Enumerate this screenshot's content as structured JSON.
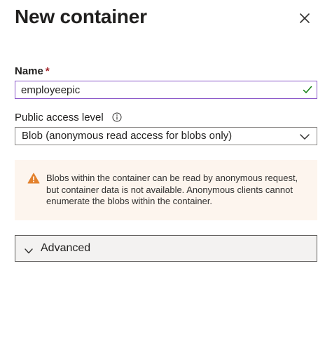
{
  "panel": {
    "title": "New container",
    "close_icon": "close-icon"
  },
  "name_field": {
    "label": "Name",
    "required_marker": "*",
    "value": "employeepic",
    "valid_icon": "checkmark-icon"
  },
  "access_level": {
    "label": "Public access level",
    "info_icon": "info-icon",
    "selected": "Blob (anonymous read access for blobs only)",
    "chevron_icon": "chevron-down-icon"
  },
  "warning": {
    "icon": "warning-icon",
    "text": "Blobs within the container can be read by anonymous request, but container data is not available. Anonymous clients cannot enumerate the blobs within the container."
  },
  "advanced": {
    "label": "Advanced",
    "chevron_icon": "chevron-down-icon"
  },
  "colors": {
    "required": "#a4262c",
    "focus_border": "#8a56c8",
    "valid_check": "#107c10",
    "warning_icon": "#e3812d",
    "warning_bg": "#fdf5ee",
    "advanced_bg": "#f3f2f1"
  }
}
